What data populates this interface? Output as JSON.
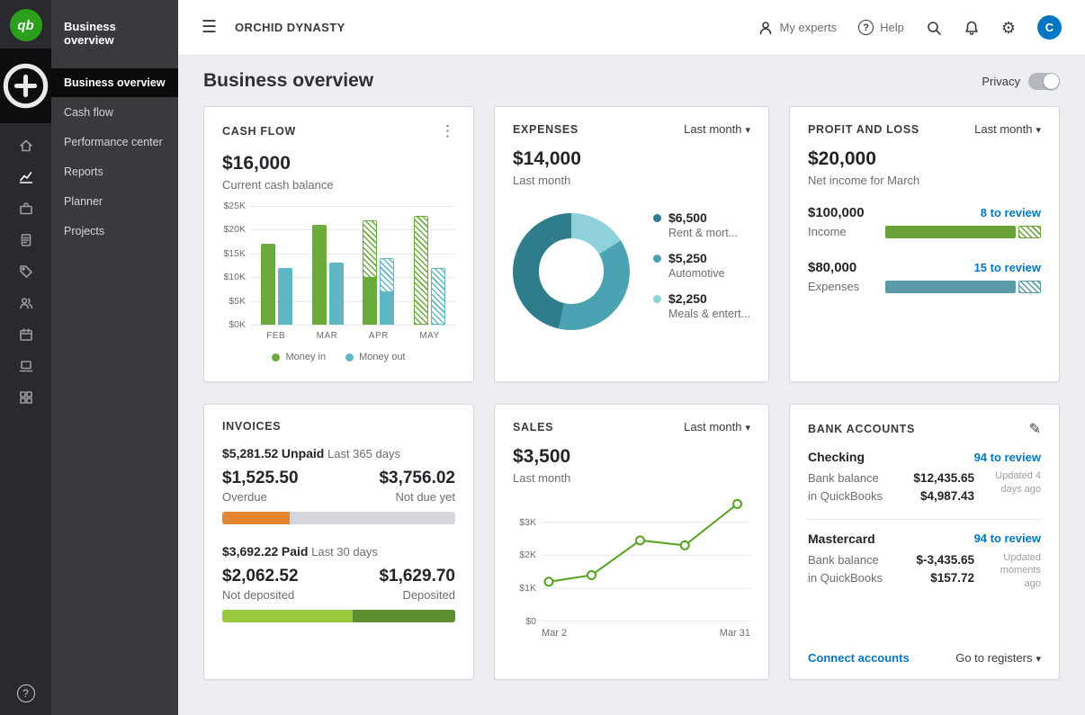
{
  "colors": {
    "brand_green": "#2ca01c",
    "link_blue": "#0077c5",
    "money_in_green": "#6aab3c",
    "money_out_teal": "#5fb7c4",
    "sales_line_green": "#52a31f"
  },
  "icons": {
    "hamburger": "☰",
    "gear": "⚙",
    "question_mark": "?",
    "kebab": "⋮",
    "pencil": "✎",
    "caret_down": "",
    "rail_icon_names": [
      "plus-circle",
      "home",
      "chart-line",
      "bank",
      "receipt",
      "tag",
      "users",
      "calendar",
      "device",
      "apps-grid",
      "help"
    ]
  },
  "rail": {
    "logo": "qb",
    "help": "?"
  },
  "sidebar": {
    "header": "Business overview",
    "items": [
      {
        "label": "Business overview",
        "active": true
      },
      {
        "label": "Cash flow",
        "active": false
      },
      {
        "label": "Performance center",
        "active": false
      },
      {
        "label": "Reports",
        "active": false
      },
      {
        "label": "Planner",
        "active": false
      },
      {
        "label": "Projects",
        "active": false
      }
    ]
  },
  "topbar": {
    "company": "ORCHID DYNASTY",
    "my_experts_label": "My experts",
    "help_label": "Help",
    "avatar_initial": "C"
  },
  "page": {
    "title": "Business overview",
    "privacy_label": "Privacy"
  },
  "cards": {
    "cash_flow": {
      "title": "CASH FLOW",
      "amount": "$16,000",
      "subtitle": "Current cash balance",
      "legend": [
        {
          "label": "Money in",
          "color": "#6aab3c"
        },
        {
          "label": "Money out",
          "color": "#5fb7c4"
        }
      ],
      "chart": {
        "type": "bar",
        "ymax": 25000,
        "yticks": [
          "$25K",
          "$20K",
          "$15K",
          "$10K",
          "$5K",
          "$0K"
        ],
        "months": [
          "FEB",
          "MAR",
          "APR",
          "MAY"
        ],
        "series": [
          {
            "month": "FEB",
            "in_total": 17000,
            "in_solid": 17000,
            "out_total": 12000,
            "out_solid": 12000
          },
          {
            "month": "MAR",
            "in_total": 21000,
            "in_solid": 21000,
            "out_total": 13000,
            "out_solid": 13000
          },
          {
            "month": "APR",
            "in_total": 22000,
            "in_solid": 10000,
            "out_total": 14000,
            "out_solid": 7000
          },
          {
            "month": "MAY",
            "in_total": 23000,
            "in_solid": 0,
            "out_total": 12000,
            "out_solid": 0
          }
        ]
      }
    },
    "expenses": {
      "title": "EXPENSES",
      "period": "Last month",
      "amount": "$14,000",
      "subtitle": "Last month",
      "chart_type": "donut",
      "total": 14000,
      "slices": [
        {
          "value": 6500,
          "amount": "$6,500",
          "label": "Rent & mort...",
          "color": "#2e7d8c"
        },
        {
          "value": 5250,
          "amount": "$5,250",
          "label": "Automotive",
          "color": "#4ba2b2"
        },
        {
          "value": 2250,
          "amount": "$2,250",
          "label": "Meals & entert...",
          "color": "#8fd1da"
        }
      ]
    },
    "profit_loss": {
      "title": "PROFIT AND LOSS",
      "period": "Last month",
      "amount": "$20,000",
      "subtitle": "Net income for March",
      "rows": [
        {
          "amount": "$100,000",
          "label": "Income",
          "review": "8 to review",
          "color": "#6aa23a",
          "solid_pct": 84
        },
        {
          "amount": "$80,000",
          "label": "Expenses",
          "review": "15 to review",
          "color": "#5b9aa9",
          "solid_pct": 84
        }
      ]
    },
    "invoices": {
      "title": "INVOICES",
      "unpaid": {
        "amount": "$5,281.52",
        "status": "Unpaid",
        "period": "Last 365 days",
        "left": {
          "amount": "$1,525.50",
          "label": "Overdue"
        },
        "right": {
          "amount": "$3,756.02",
          "label": "Not due yet"
        },
        "bar": {
          "left_pct": 28.9,
          "left_color": "#e3862f",
          "right_color": "#d4d7dc"
        }
      },
      "paid": {
        "amount": "$3,692.22",
        "status": "Paid",
        "period": "Last 30 days",
        "left": {
          "amount": "$2,062.52",
          "label": "Not deposited"
        },
        "right": {
          "amount": "$1,629.70",
          "label": "Deposited"
        },
        "bar": {
          "left_pct": 55.9,
          "left_color": "#97c83d",
          "right_color": "#5d8f2f"
        }
      }
    },
    "sales": {
      "title": "SALES",
      "period": "Last month",
      "amount": "$3,500",
      "subtitle": "Last month",
      "chart": {
        "type": "line",
        "color": "#52a31f",
        "ymax": 3750,
        "yticks": [
          "$3K",
          "$2K",
          "$1K",
          "$0"
        ],
        "ytick_values": [
          3000,
          2000,
          1000,
          0
        ],
        "xlabels": [
          "Mar 2",
          "Mar 31"
        ],
        "points": [
          {
            "x": 0,
            "y": 1200
          },
          {
            "x": 22,
            "y": 1400
          },
          {
            "x": 47,
            "y": 2450
          },
          {
            "x": 70,
            "y": 2300
          },
          {
            "x": 97,
            "y": 3550
          }
        ]
      }
    },
    "bank_accounts": {
      "title": "BANK ACCOUNTS",
      "accounts": [
        {
          "name": "Checking",
          "review": "94 to review",
          "bank_balance_label": "Bank balance",
          "bank_balance": "$12,435.65",
          "qb_label": "in QuickBooks",
          "qb_balance": "$4,987.43",
          "updated": "Updated 4 days ago"
        },
        {
          "name": "Mastercard",
          "review": "94 to review",
          "bank_balance_label": "Bank balance",
          "bank_balance": "$-3,435.65",
          "qb_label": "in QuickBooks",
          "qb_balance": "$157.72",
          "updated": "Updated moments ago"
        }
      ],
      "connect_label": "Connect accounts",
      "registers_label": "Go to registers"
    }
  }
}
